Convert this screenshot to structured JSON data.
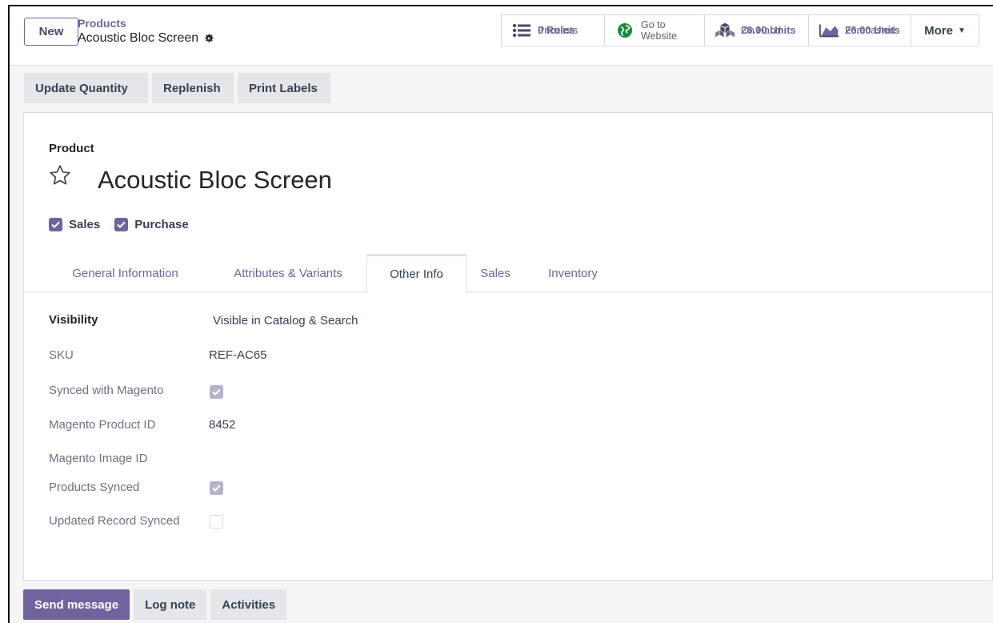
{
  "control_panel": {
    "new_label": "New",
    "breadcrumb_parent": "Products",
    "breadcrumb_current": "Acoustic Bloc Screen",
    "stats": [
      {
        "label": "Pricelists",
        "value": "0 Rules",
        "icon": "list-icon"
      },
      {
        "label": "Go to",
        "value": "Website",
        "icon": "globe-icon"
      },
      {
        "label": "On Hand",
        "value": "26.00 Units",
        "icon": "cubes-icon"
      },
      {
        "label": "Forecasted",
        "value": "26.00 Units",
        "icon": "area-chart-icon"
      }
    ],
    "more_label": "More"
  },
  "actions": {
    "update_quantity": "Update Quantity",
    "replenish": "Replenish",
    "print_labels": "Print Labels"
  },
  "sheet": {
    "product_label": "Product",
    "product_name": "Acoustic Bloc Screen",
    "sales_label": "Sales",
    "purchase_label": "Purchase"
  },
  "tabs": [
    "General Information",
    "Attributes & Variants",
    "Other Info",
    "Sales",
    "Inventory"
  ],
  "active_tab": "Other Info",
  "fields": {
    "visibility_label": "Visibility",
    "visibility_value": "Visible in Catalog & Search",
    "sku_label": "SKU",
    "sku_value": "REF-AC65",
    "synced_label": "Synced with Magento",
    "magento_pid_label": "Magento Product ID",
    "magento_pid_value": "8452",
    "magento_img_label": "Magento Image ID",
    "products_synced_label": "Products Synced",
    "updated_synced_label": "Updated Record Synced"
  },
  "chatter": {
    "send_message": "Send message",
    "log_note": "Log note",
    "activities": "Activities"
  },
  "colors": {
    "accent": "#71639e"
  }
}
